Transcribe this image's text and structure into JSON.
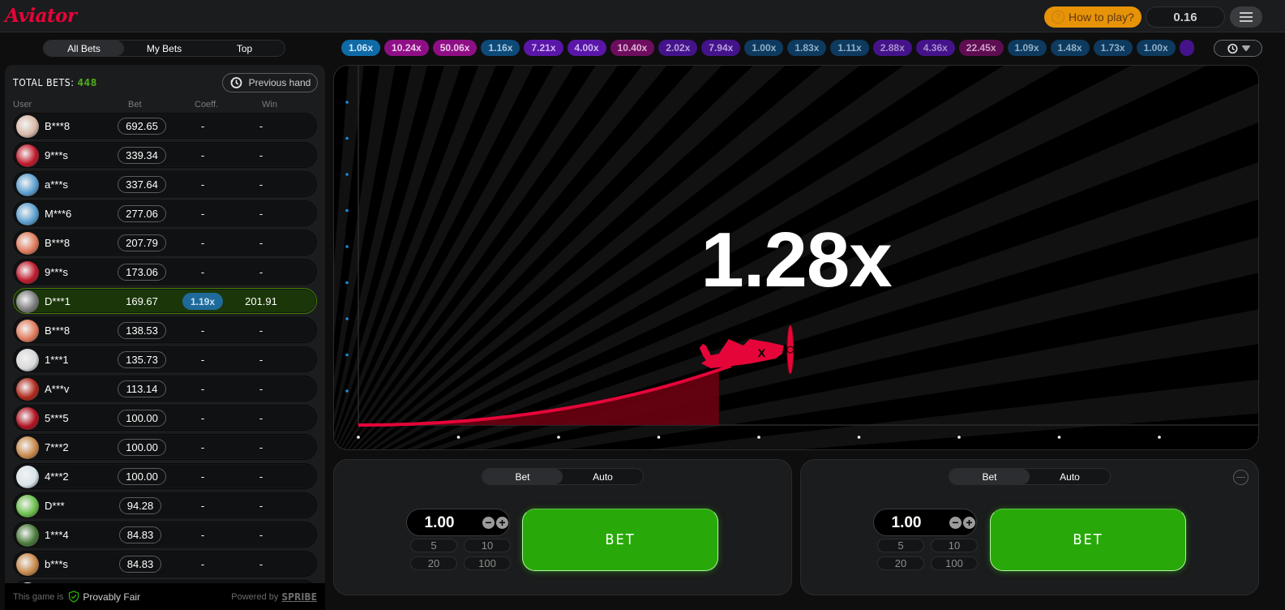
{
  "header": {
    "logo": "Aviator",
    "how_to_play": "How to play?",
    "balance": "0.16"
  },
  "bet_tabs": [
    "All Bets",
    "My Bets",
    "Top"
  ],
  "bets_panel": {
    "total_label": "TOTAL BETS:",
    "total_count": "448",
    "previous_hand": "Previous hand",
    "columns": {
      "user": "User",
      "bet": "Bet",
      "coeff": "Coeff.",
      "win": "Win"
    },
    "rows": [
      {
        "user": "B***8",
        "bet": "692.65",
        "coeff": "-",
        "win": "-",
        "avatar_color": "#d9b8a8",
        "won": false
      },
      {
        "user": "9***s",
        "bet": "339.34",
        "coeff": "-",
        "win": "-",
        "avatar_color": "#c0182a",
        "won": false
      },
      {
        "user": "a***s",
        "bet": "337.64",
        "coeff": "-",
        "win": "-",
        "avatar_color": "#5a9fd0",
        "won": false
      },
      {
        "user": "M***6",
        "bet": "277.06",
        "coeff": "-",
        "win": "-",
        "avatar_color": "#5a9fd0",
        "won": false
      },
      {
        "user": "B***8",
        "bet": "207.79",
        "coeff": "-",
        "win": "-",
        "avatar_color": "#e07a5a",
        "won": false
      },
      {
        "user": "9***s",
        "bet": "173.06",
        "coeff": "-",
        "win": "-",
        "avatar_color": "#c0182a",
        "won": false
      },
      {
        "user": "D***1",
        "bet": "169.67",
        "coeff": "1.19x",
        "win": "201.91",
        "avatar_color": "#7a7a7a",
        "won": true
      },
      {
        "user": "B***8",
        "bet": "138.53",
        "coeff": "-",
        "win": "-",
        "avatar_color": "#e07a5a",
        "won": false
      },
      {
        "user": "1***1",
        "bet": "135.73",
        "coeff": "-",
        "win": "-",
        "avatar_color": "#d8d8d8",
        "won": false
      },
      {
        "user": "A***v",
        "bet": "113.14",
        "coeff": "-",
        "win": "-",
        "avatar_color": "#b0281a",
        "won": false
      },
      {
        "user": "5***5",
        "bet": "100.00",
        "coeff": "-",
        "win": "-",
        "avatar_color": "#b01020",
        "won": false
      },
      {
        "user": "7***2",
        "bet": "100.00",
        "coeff": "-",
        "win": "-",
        "avatar_color": "#c8884a",
        "won": false
      },
      {
        "user": "4***2",
        "bet": "100.00",
        "coeff": "-",
        "win": "-",
        "avatar_color": "#d8e4ea",
        "won": false
      },
      {
        "user": "D***",
        "bet": "94.28",
        "coeff": "-",
        "win": "-",
        "avatar_color": "#6abf4a",
        "won": false
      },
      {
        "user": "1***4",
        "bet": "84.83",
        "coeff": "-",
        "win": "-",
        "avatar_color": "#4a7a3a",
        "won": false
      },
      {
        "user": "b***s",
        "bet": "84.83",
        "coeff": "-",
        "win": "-",
        "avatar_color": "#c8884a",
        "won": false
      },
      {
        "user": "",
        "bet": "",
        "coeff": "",
        "win": "",
        "avatar_color": "#e8e8e8",
        "won": false
      }
    ]
  },
  "footer": {
    "this_game_is": "This game is",
    "provably_fair": "Provably Fair",
    "powered_by": "Powered by",
    "spribe": "SPRIBE"
  },
  "history": [
    {
      "value": "1.06x",
      "bg": "#0f6aa6",
      "fg": "#d0e8fa"
    },
    {
      "value": "10.24x",
      "bg": "#8e0f85",
      "fg": "#f0c8ec"
    },
    {
      "value": "50.06x",
      "bg": "#8e0f85",
      "fg": "#f0c8ec"
    },
    {
      "value": "1.16x",
      "bg": "#0d4a78",
      "fg": "#a8c8e0"
    },
    {
      "value": "7.21x",
      "bg": "#5a16a8",
      "fg": "#d0b8f0"
    },
    {
      "value": "4.00x",
      "bg": "#5a16a8",
      "fg": "#d0b8f0"
    },
    {
      "value": "10.40x",
      "bg": "#6e0d5e",
      "fg": "#e0b0d8"
    },
    {
      "value": "2.02x",
      "bg": "#44138a",
      "fg": "#b8a0e0"
    },
    {
      "value": "7.94x",
      "bg": "#44138a",
      "fg": "#b8a0e0"
    },
    {
      "value": "1.00x",
      "bg": "#0d3a5e",
      "fg": "#90b0c8"
    },
    {
      "value": "1.83x",
      "bg": "#0d3a5e",
      "fg": "#90b0c8"
    },
    {
      "value": "1.11x",
      "bg": "#0d3a5e",
      "fg": "#90b0c8"
    },
    {
      "value": "2.88x",
      "bg": "#44138a",
      "fg": "#a890d0"
    },
    {
      "value": "4.36x",
      "bg": "#44138a",
      "fg": "#a890d0"
    },
    {
      "value": "22.45x",
      "bg": "#5e0d52",
      "fg": "#d0a0c8"
    },
    {
      "value": "1.09x",
      "bg": "#0d3a5e",
      "fg": "#90b0c8"
    },
    {
      "value": "1.48x",
      "bg": "#0d3a5e",
      "fg": "#90b0c8"
    },
    {
      "value": "1.73x",
      "bg": "#0d3a5e",
      "fg": "#90b0c8"
    },
    {
      "value": "1.00x",
      "bg": "#0d3a5e",
      "fg": "#90b0c8"
    },
    {
      "value": "",
      "bg": "#44138a",
      "fg": "#a890d0"
    }
  ],
  "game": {
    "multiplier": "1.28x",
    "progress_fraction": 0.36
  },
  "bet_panels": [
    {
      "tabs": [
        "Bet",
        "Auto"
      ],
      "amount": "1.00",
      "quick": [
        "5",
        "10",
        "20",
        "100"
      ],
      "bet_label": "BET"
    },
    {
      "tabs": [
        "Bet",
        "Auto"
      ],
      "amount": "1.00",
      "quick": [
        "5",
        "10",
        "20",
        "100"
      ],
      "bet_label": "BET"
    }
  ],
  "colors": {
    "accent_red": "#e50539",
    "bet_green": "#28a909",
    "total_green": "#4fa71a",
    "howto_orange": "#e69308"
  }
}
